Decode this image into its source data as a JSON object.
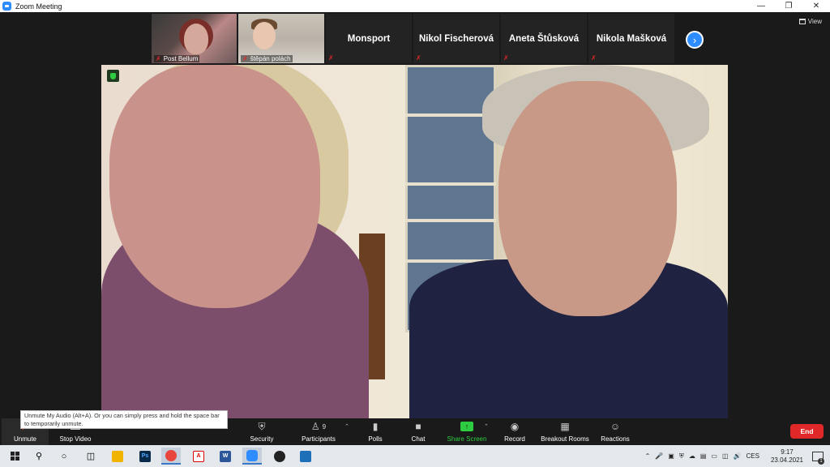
{
  "window": {
    "title": "Zoom Meeting",
    "minimize_icon": "minimize-icon",
    "restore_icon": "restore-icon",
    "close_icon": "close-icon"
  },
  "view_button": {
    "label": "View"
  },
  "thumbnails": [
    {
      "type": "video",
      "name": "Post Bellum",
      "muted": true
    },
    {
      "type": "video",
      "name": "štěpán polách",
      "muted": true
    },
    {
      "type": "name",
      "name": "Monsport",
      "muted": true
    },
    {
      "type": "name",
      "name": "Nikol Fischerová",
      "muted": true
    },
    {
      "type": "name",
      "name": "Aneta Štůsková",
      "muted": true
    },
    {
      "type": "name",
      "name": "Nikola Mašková",
      "muted": true
    }
  ],
  "tooltip": {
    "text": "Unmute My Audio (Alt+A). Or you can simply press and hold the space bar to temporarily unmute."
  },
  "toolbar": {
    "unmute": "Unmute",
    "stop_video": "Stop Video",
    "security": "Security",
    "participants": "Participants",
    "participants_count": "9",
    "polls": "Polls",
    "chat": "Chat",
    "share_screen": "Share Screen",
    "record": "Record",
    "breakout_rooms": "Breakout Rooms",
    "reactions": "Reactions",
    "end": "End"
  },
  "taskbar": {
    "language": "CES",
    "time": "9:17",
    "date": "23.04.2021",
    "notification_count": "1"
  },
  "colors": {
    "accent": "#2d8cff",
    "end": "#e02828",
    "share": "#2ecc40",
    "mute": "#e02828"
  }
}
